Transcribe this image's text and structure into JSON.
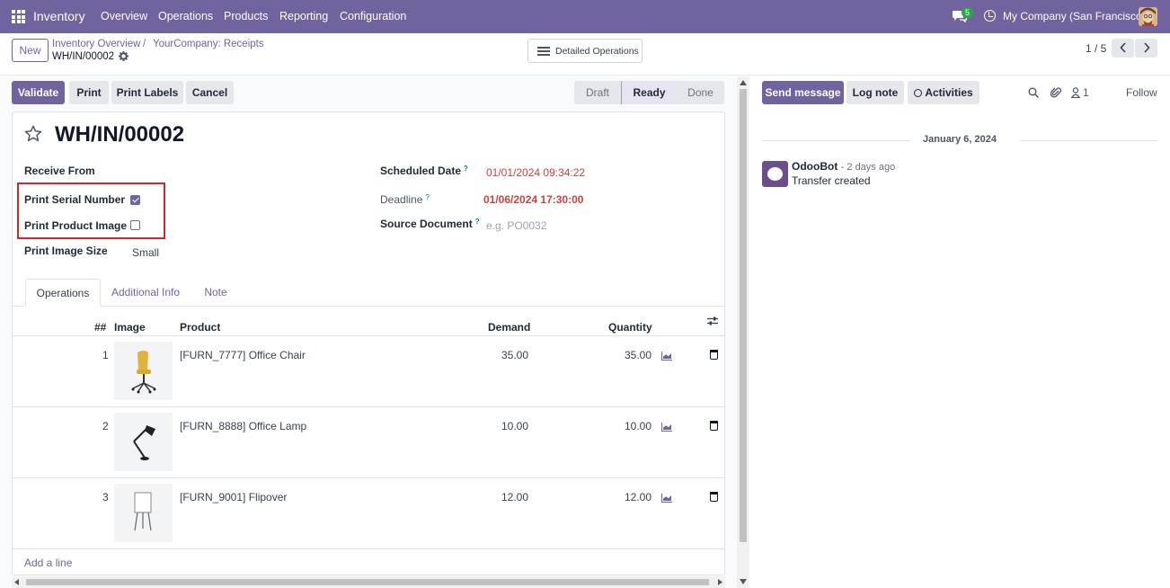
{
  "navbar": {
    "brand": "Inventory",
    "menu": [
      "Overview",
      "Operations",
      "Products",
      "Reporting",
      "Configuration"
    ],
    "chat_count": "5",
    "company": "My Company (San Francisco)",
    "accent": "#71639e"
  },
  "control_panel": {
    "new_label": "New",
    "breadcrumb": [
      "Inventory Overview",
      "YourCompany: Receipts"
    ],
    "breadcrumb_sep": "/",
    "record_name": "WH/IN/00002",
    "detailed_ops_label": "Detailed Operations",
    "pager": "1 / 5"
  },
  "actions": {
    "validate": "Validate",
    "print": "Print",
    "print_labels": "Print Labels",
    "cancel": "Cancel"
  },
  "status": {
    "stages": [
      "Draft",
      "Ready",
      "Done"
    ],
    "current": "Ready"
  },
  "form": {
    "title": "WH/IN/00002",
    "receive_from_label": "Receive From",
    "print_serial_label": "Print Serial Number",
    "print_serial_checked": true,
    "print_image_label": "Print Product Image",
    "print_image_checked": false,
    "image_size_label": "Print Image Size",
    "image_size_value": "Small",
    "scheduled_label": "Scheduled Date",
    "scheduled_value": "01/01/2024 09:34:22",
    "deadline_label": "Deadline",
    "deadline_value": "01/06/2024 17:30:00",
    "source_label": "Source Document",
    "source_placeholder": "e.g. PO0032",
    "help_mark": "?"
  },
  "tabs": [
    "Operations",
    "Additional Info",
    "Note"
  ],
  "table": {
    "headers": {
      "num": "##",
      "image": "Image",
      "product": "Product",
      "demand": "Demand",
      "quantity": "Quantity"
    },
    "rows": [
      {
        "num": "1",
        "product": "[FURN_7777] Office Chair",
        "demand": "35.00",
        "quantity": "35.00"
      },
      {
        "num": "2",
        "product": "[FURN_8888] Office Lamp",
        "demand": "10.00",
        "quantity": "10.00"
      },
      {
        "num": "3",
        "product": "[FURN_9001] Flipover",
        "demand": "12.00",
        "quantity": "12.00"
      }
    ],
    "add_line": "Add a line"
  },
  "chatter": {
    "send_message": "Send message",
    "log_note": "Log note",
    "activities": "Activities",
    "attachments_count": "",
    "followers_count": "1",
    "follow": "Follow",
    "date": "January 6, 2024",
    "author": "OdooBot",
    "time": "- 2 days ago",
    "message": "Transfer created"
  }
}
